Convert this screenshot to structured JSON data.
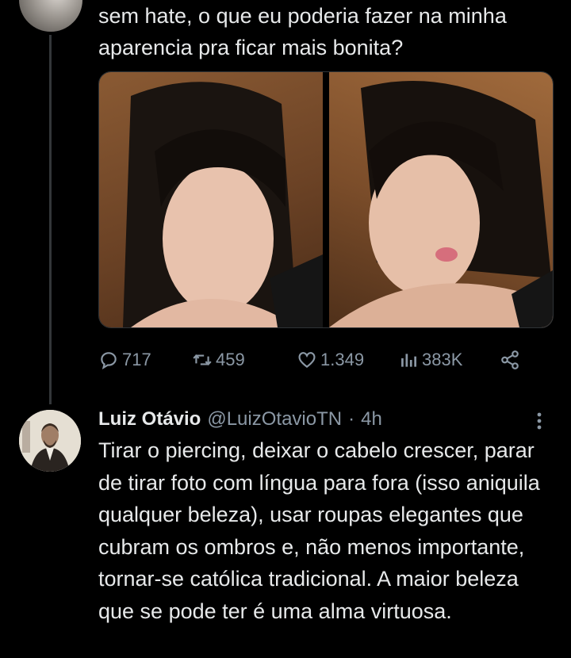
{
  "original_tweet": {
    "text": "sem hate, o que eu poderia fazer na minha aparencia pra ficar mais bonita?",
    "stats": {
      "replies": "717",
      "retweets": "459",
      "likes": "1.349",
      "views": "383K"
    }
  },
  "reply": {
    "name": "Luiz Otávio",
    "handle": "@LuizOtavioTN",
    "separator": "·",
    "time": "4h",
    "text": "Tirar o piercing, deixar o cabelo crescer, parar de tirar foto com língua para fora (isso aniquila qualquer beleza), usar roupas elegantes que cubram os ombros e, não menos importante, tornar-se católica tradicional. A maior beleza que se pode ter é uma alma virtuosa."
  },
  "icons": {
    "reply": "reply-icon",
    "retweet": "retweet-icon",
    "like": "heart-icon",
    "views": "views-icon",
    "share": "share-icon",
    "more": "more-icon"
  },
  "colors": {
    "background": "#000000",
    "text": "#e7e9ea",
    "secondary": "#8b98a5",
    "thread_line": "#333639"
  }
}
